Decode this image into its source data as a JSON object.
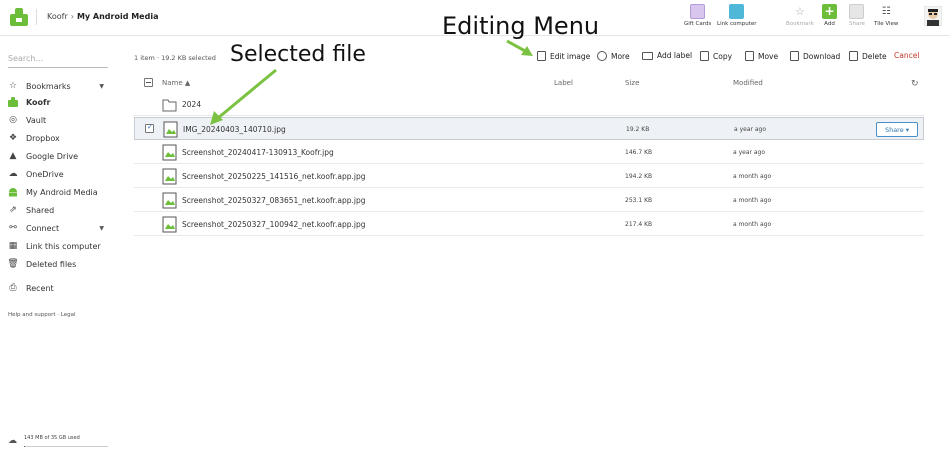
{
  "breadcrumb": {
    "root": "Koofr",
    "separator": "›",
    "current": "My Android Media"
  },
  "topbar": {
    "gift_cards": "Gift Cards",
    "link_computer": "Link computer",
    "bookmark": "Bookmark",
    "add": "Add",
    "share": "Share",
    "tile_view": "Tile View"
  },
  "annotations": {
    "editing_menu": "Editing Menu",
    "selected_file": "Selected file"
  },
  "search": {
    "placeholder": "Search..."
  },
  "sidebar": {
    "items": [
      {
        "label": "Bookmarks",
        "icon": "star-icon"
      },
      {
        "label": "Koofr",
        "icon": "koofr-icon"
      },
      {
        "label": "Vault",
        "icon": "vault-icon"
      },
      {
        "label": "Dropbox",
        "icon": "dropbox-icon"
      },
      {
        "label": "Google Drive",
        "icon": "google-drive-icon"
      },
      {
        "label": "OneDrive",
        "icon": "cloud-icon"
      },
      {
        "label": "My Android Media",
        "icon": "android-icon"
      },
      {
        "label": "Shared",
        "icon": "share-icon"
      },
      {
        "label": "Connect",
        "icon": "connect-icon"
      },
      {
        "label": "Link this computer",
        "icon": "windows-icon"
      },
      {
        "label": "Deleted files",
        "icon": "trash-icon"
      },
      {
        "label": "Recent",
        "icon": "recent-icon"
      }
    ],
    "help": "Help and support · Legal",
    "storage": {
      "text": "143 MB of 35 GB used",
      "used_fraction": 0.004
    }
  },
  "actions": {
    "selection_info": "1 item · 19.2 KB selected",
    "edit_image": "Edit image",
    "more": "More",
    "add_label": "Add label",
    "copy": "Copy",
    "move": "Move",
    "download": "Download",
    "delete": "Delete",
    "cancel": "Cancel"
  },
  "table": {
    "headers": {
      "name": "Name ▲",
      "label": "Label",
      "size": "Size",
      "modified": "Modified"
    },
    "rows": [
      {
        "name": "2024",
        "type": "folder",
        "size": "",
        "modified": ""
      },
      {
        "name": "IMG_20240403_140710.jpg",
        "type": "image",
        "size": "19.2 KB",
        "modified": "a year ago",
        "selected": true
      },
      {
        "name": "Screenshot_20240417-130913_Koofr.jpg",
        "type": "image",
        "size": "146.7 KB",
        "modified": "a year ago"
      },
      {
        "name": "Screenshot_20250225_141516_net.koofr.app.jpg",
        "type": "image",
        "size": "194.2 KB",
        "modified": "a month ago"
      },
      {
        "name": "Screenshot_20250327_083651_net.koofr.app.jpg",
        "type": "image",
        "size": "253.1 KB",
        "modified": "a month ago"
      },
      {
        "name": "Screenshot_20250327_100942_net.koofr.app.jpg",
        "type": "image",
        "size": "217.4 KB",
        "modified": "a month ago"
      }
    ],
    "share_label": "Share ▾"
  },
  "colors": {
    "brand_green": "#6cbe3a",
    "accent_blue": "#2b78b8",
    "cancel_red": "#c0392b",
    "annotation_arrow": "#7cc242"
  }
}
